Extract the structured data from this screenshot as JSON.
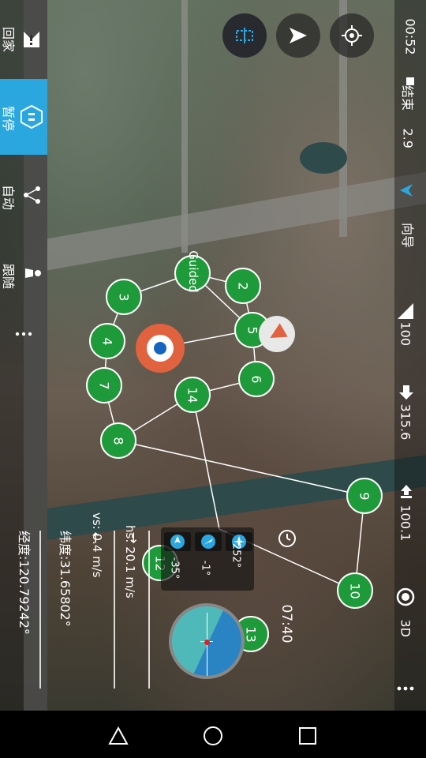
{
  "status": {
    "time": "00:52",
    "end_label": "结束",
    "battery_voltage": "2.9",
    "heading_label": "向导",
    "signal": "100",
    "altitude_sea": "315.6",
    "altitude_rel": "100.1",
    "view_mode": "3D"
  },
  "left_menu": {
    "return_label": "回家",
    "pause_label": "暂停",
    "auto_label": "自动",
    "follow_label": "跟随"
  },
  "map": {
    "mode_label": "Guided",
    "waypoints": [
      "2",
      "3",
      "4",
      "5",
      "6",
      "7",
      "8",
      "9",
      "10",
      "12",
      "13",
      "14"
    ]
  },
  "hud": {
    "yaw": "252°",
    "pitch": "-1°",
    "roll": "-35°",
    "flight_time": "07:40",
    "hs": "hs: 20.1 m/s",
    "vs": "vs: 0.4 m/s",
    "lat": "纬度:31.65802°",
    "lon": "经度:120.79242°"
  },
  "icons": {
    "accent": "#2ba7e0",
    "green": "#1f9a3a"
  }
}
